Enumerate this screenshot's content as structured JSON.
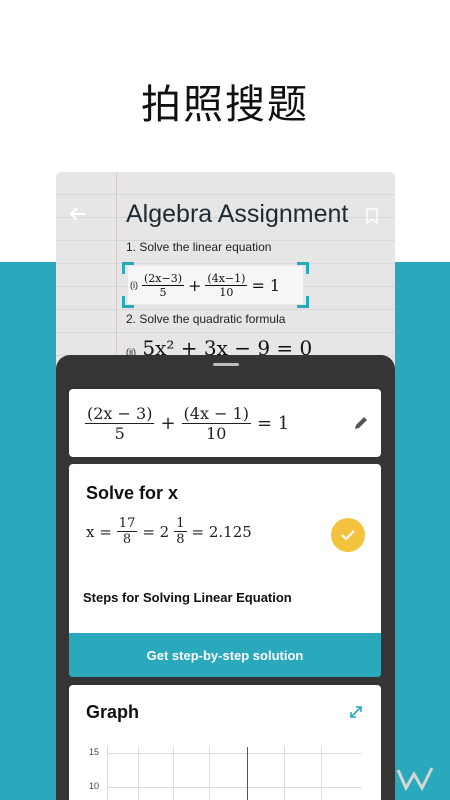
{
  "headline": "拍照搜题",
  "document": {
    "title": "Algebra Assignment",
    "question1": "1. Solve the linear equation",
    "question2": "2. Solve the quadratic formula",
    "eq1_label": "(i)",
    "eq2_label": "(ii)"
  },
  "equation": {
    "term1_num": "(2x − 3)",
    "term1_den": "5",
    "plus": "+",
    "term2_num": "(4x − 1)",
    "term2_den": "10",
    "rhs": "= 1"
  },
  "scan_equation": {
    "term1_num": "(2x−3)",
    "term1_den": "5",
    "plus": "+",
    "term2_num": "(4x−1)",
    "term2_den": "10",
    "rhs": "= 1"
  },
  "quadratic": {
    "expr": "5x² + 3x − 9 = 0"
  },
  "solve": {
    "title": "Solve for x",
    "lhs": "x =",
    "frac_num": "17",
    "frac_den": "8",
    "eq2": "= 2",
    "mixed_num": "1",
    "mixed_den": "8",
    "decimal": "= 2.125",
    "steps_label": "Steps for Solving Linear Equation",
    "button_label": "Get step-by-step solution"
  },
  "graph": {
    "title": "Graph",
    "y_ticks": [
      "15",
      "10"
    ]
  },
  "colors": {
    "accent": "#2aa8bc",
    "check": "#f3c33d",
    "sheet": "#353535"
  },
  "icons": [
    "back-arrow-icon",
    "bookmark-icon",
    "pencil-icon",
    "check-icon",
    "expand-icon"
  ]
}
